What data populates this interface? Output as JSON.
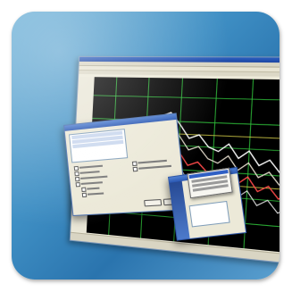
{
  "tile": {
    "name": "software-screenshot-collage"
  },
  "colors": {
    "tile_top": "#6fb2d8",
    "tile_bottom": "#2a74ae",
    "chart_bg": "#000000",
    "grid": "#2fbf3a",
    "series": [
      "#ffffff",
      "#e8e0d0",
      "#ff4a4a",
      "#f0f0f0"
    ]
  }
}
